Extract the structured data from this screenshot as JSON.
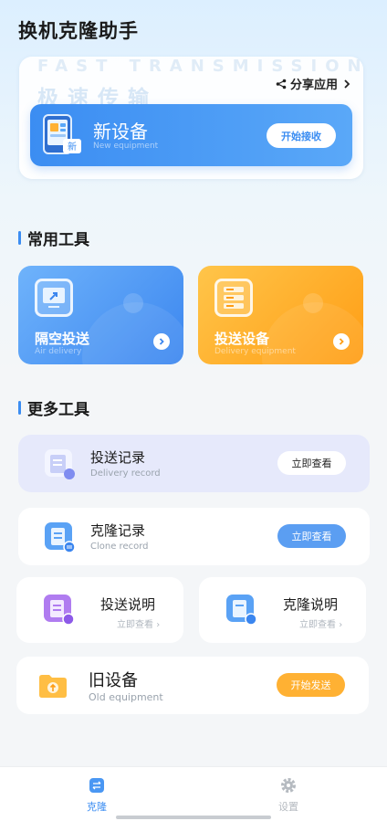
{
  "app": {
    "title": "换机克隆助手"
  },
  "hero": {
    "watermark_en": "FAST TRANSMISSION",
    "watermark_cn": "极速传输",
    "share_label": "分享应用",
    "new_device": {
      "title": "新设备",
      "subtitle": "New equipment",
      "button": "开始接收"
    }
  },
  "sections": {
    "common_tools": "常用工具",
    "more_tools": "更多工具"
  },
  "tools": [
    {
      "title": "隔空投送",
      "subtitle": "Air delivery",
      "color": "#3b86ef"
    },
    {
      "title": "投送设备",
      "subtitle": "Delivery equipment",
      "color": "#ff9d14"
    }
  ],
  "records": [
    {
      "title": "投送记录",
      "subtitle": "Delivery record",
      "button": "立即查看"
    },
    {
      "title": "克隆记录",
      "subtitle": "Clone record",
      "button": "立即查看"
    }
  ],
  "guides": [
    {
      "title": "投送说明",
      "link": "立即查看"
    },
    {
      "title": "克隆说明",
      "link": "立即查看"
    }
  ],
  "old_device": {
    "title": "旧设备",
    "subtitle": "Old equipment",
    "button": "开始发送"
  },
  "nav": {
    "home": "克隆",
    "settings": "设置"
  },
  "colors": {
    "accent": "#3b8df2",
    "orange": "#ffb133"
  }
}
